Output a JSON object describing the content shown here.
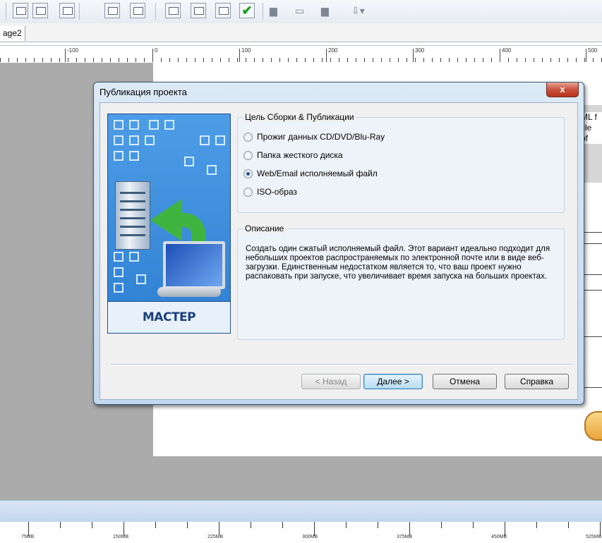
{
  "tabs": [
    {
      "label": "age2"
    }
  ],
  "ruler": {
    "labels": [
      "-100",
      "0",
      "100",
      "200",
      "300",
      "400",
      "500"
    ]
  },
  "side_text": [
    "ML f",
    "file",
    "of"
  ],
  "timeline": {
    "labels": [
      "75MB",
      "150MB",
      "225MB",
      "300MB",
      "375MB",
      "450MB",
      "525MB"
    ]
  },
  "dialog": {
    "title": "Публикация проекта",
    "close_label": "x",
    "wizard_caption": "МАСТЕР ПУБЛИКАЦИИ",
    "target_group": {
      "legend": "Цель Сборки & Публикации",
      "options": [
        {
          "label": "Прожиг данных CD/DVD/Blu-Ray",
          "checked": false
        },
        {
          "label": "Папка жесткого диска",
          "checked": false
        },
        {
          "label": "Web/Email исполняемый файл",
          "checked": true
        },
        {
          "label": "ISO-образ",
          "checked": false
        }
      ]
    },
    "description_group": {
      "legend": "Описание",
      "text": "Создать один сжатый исполняемый файл. Этот вариант идеально подходит для небольших проектов распространяемых по электронной почте или в виде веб-загрузки. Единственным недостатком является то, что ваш проект нужно распаковать при запуске, что увеличивает время запуска на больших проектах."
    },
    "buttons": {
      "back": "< Назад",
      "next": "Далее >",
      "cancel": "Отмена",
      "help": "Справка"
    }
  },
  "colors": {
    "dialog_frame": "#c4d8ee",
    "workspace": "#ababab",
    "wizard_blue": "#2f7fd3",
    "close_red": "#c7523d"
  }
}
